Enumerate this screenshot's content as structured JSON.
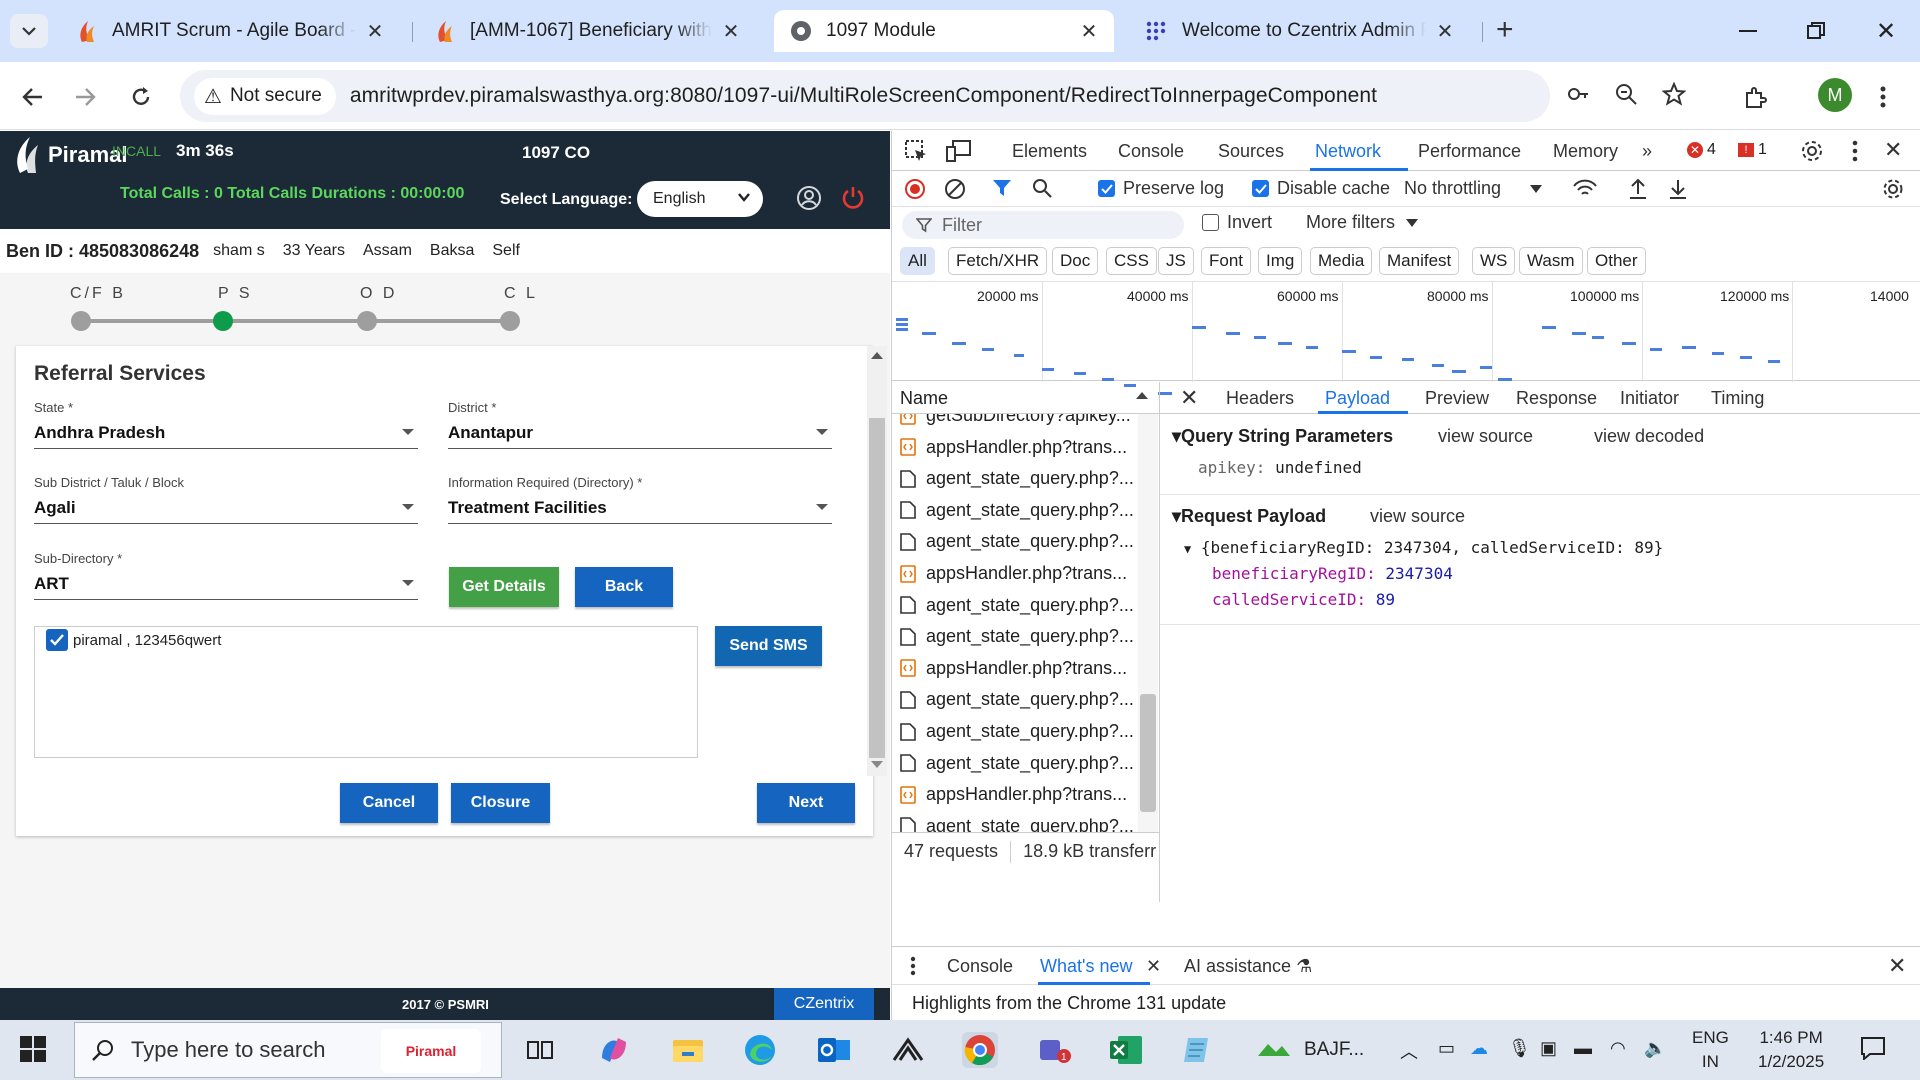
{
  "browser": {
    "tabs": [
      {
        "title": "AMRIT Scrum - Agile Board - Jira",
        "active": false
      },
      {
        "title": "[AMM-1067] Beneficiary with Mobile",
        "active": false
      },
      {
        "title": "1097 Module",
        "active": true
      },
      {
        "title": "Welcome to Czentrix Admin Panel",
        "active": false
      }
    ],
    "not_secure_label": "Not secure",
    "url": "amritwprdev.piramalswasthya.org:8080/1097-ui/MultiRoleScreenComponent/RedirectToInnerpageComponent",
    "profile_initial": "M"
  },
  "app": {
    "brand": "Piramal",
    "call_status": "INCALL",
    "call_timer": "3m 36s",
    "module_title": "1097 CO",
    "totals": "Total Calls : 0  Total Calls Durations : 00:00:00",
    "select_language_label": "Select Language:",
    "language_value": "English",
    "beneficiary": {
      "id_label": "Ben ID : 485083086248",
      "name": "sham s",
      "age": "33 Years",
      "state": "Assam",
      "district": "Baksa",
      "relation": "Self"
    },
    "steps": [
      {
        "label": "C/F B",
        "active": false
      },
      {
        "label": "P S",
        "active": true
      },
      {
        "label": "O D",
        "active": false
      },
      {
        "label": "C L",
        "active": false
      }
    ],
    "referral": {
      "title": "Referral Services",
      "state_label": "State *",
      "state_value": "Andhra Pradesh",
      "district_label": "District *",
      "district_value": "Anantapur",
      "subdistrict_label": "Sub District / Taluk / Block",
      "subdistrict_value": "Agali",
      "info_label": "Information Required (Directory) *",
      "info_value": "Treatment Facilities",
      "subdir_label": "Sub-Directory *",
      "subdir_value": "ART",
      "get_details_label": "Get Details",
      "back_label": "Back",
      "result_item": "piramal , 123456qwert",
      "send_sms_label": "Send SMS",
      "cancel_label": "Cancel",
      "closure_label": "Closure",
      "next_label": "Next"
    },
    "footer_copy": "2017 © PSMRI",
    "footer_brand": "CZentrix"
  },
  "devtools": {
    "tabs": [
      "Elements",
      "Console",
      "Sources",
      "Network",
      "Performance",
      "Memory"
    ],
    "active_tab": "Network",
    "error_count": "4",
    "issue_count": "1",
    "toolbar": {
      "preserve_log": "Preserve log",
      "disable_cache": "Disable cache",
      "throttling": "No throttling"
    },
    "filter_placeholder": "Filter",
    "invert_label": "Invert",
    "more_filters_label": "More filters",
    "type_filters": [
      "All",
      "Fetch/XHR",
      "Doc",
      "CSS",
      "JS",
      "Font",
      "Img",
      "Media",
      "Manifest",
      "WS",
      "Wasm",
      "Other"
    ],
    "timeline_labels": [
      "20000 ms",
      "40000 ms",
      "60000 ms",
      "80000 ms",
      "100000 ms",
      "120000 ms",
      "14000"
    ],
    "name_header": "Name",
    "requests": [
      {
        "name": "getSubDirectory?apikey...",
        "kind": "xhr"
      },
      {
        "name": "appsHandler.php?trans...",
        "kind": "xhr"
      },
      {
        "name": "agent_state_query.php?...",
        "kind": "doc"
      },
      {
        "name": "agent_state_query.php?...",
        "kind": "doc"
      },
      {
        "name": "agent_state_query.php?...",
        "kind": "doc"
      },
      {
        "name": "appsHandler.php?trans...",
        "kind": "xhr"
      },
      {
        "name": "agent_state_query.php?...",
        "kind": "doc"
      },
      {
        "name": "agent_state_query.php?...",
        "kind": "doc"
      },
      {
        "name": "appsHandler.php?trans...",
        "kind": "xhr"
      },
      {
        "name": "agent_state_query.php?...",
        "kind": "doc"
      },
      {
        "name": "agent_state_query.php?...",
        "kind": "doc"
      },
      {
        "name": "agent_state_query.php?...",
        "kind": "doc"
      },
      {
        "name": "appsHandler.php?trans...",
        "kind": "xhr"
      },
      {
        "name": "agent_state_query.php?...",
        "kind": "doc"
      },
      {
        "name": "agent_state_query.php?...",
        "kind": "doc"
      }
    ],
    "requests_count": "47 requests",
    "transfer": "18.9 kB transferr",
    "detail_tabs": [
      "Headers",
      "Payload",
      "Preview",
      "Response",
      "Initiator",
      "Timing"
    ],
    "active_detail_tab": "Payload",
    "query_title": "Query String Parameters",
    "view_source": "view source",
    "view_decoded": "view decoded",
    "query_key": "apikey:",
    "query_value": "undefined",
    "payload_title": "Request Payload",
    "payload_summary": "{beneficiaryRegID: 2347304, calledServiceID: 89}",
    "payload_k1": "beneficiaryRegID:",
    "payload_v1": "2347304",
    "payload_k2": "calledServiceID:",
    "payload_v2": "89",
    "drawer_tabs": [
      "Console",
      "What's new",
      "AI assistance"
    ],
    "drawer_content": "Highlights from the Chrome 131 update"
  },
  "taskbar": {
    "search_placeholder": "Type here to search",
    "search_badge": "Piramal",
    "app_label": "BAJF...",
    "lang": "ENG",
    "region": "IN",
    "time": "1:46 PM",
    "date": "1/2/2025",
    "notif_count": "1"
  },
  "colors": {
    "app_header": "#1b2a36",
    "primary_blue": "#1565c0",
    "green": "#43a047",
    "devtools_accent": "#1a73e8"
  }
}
